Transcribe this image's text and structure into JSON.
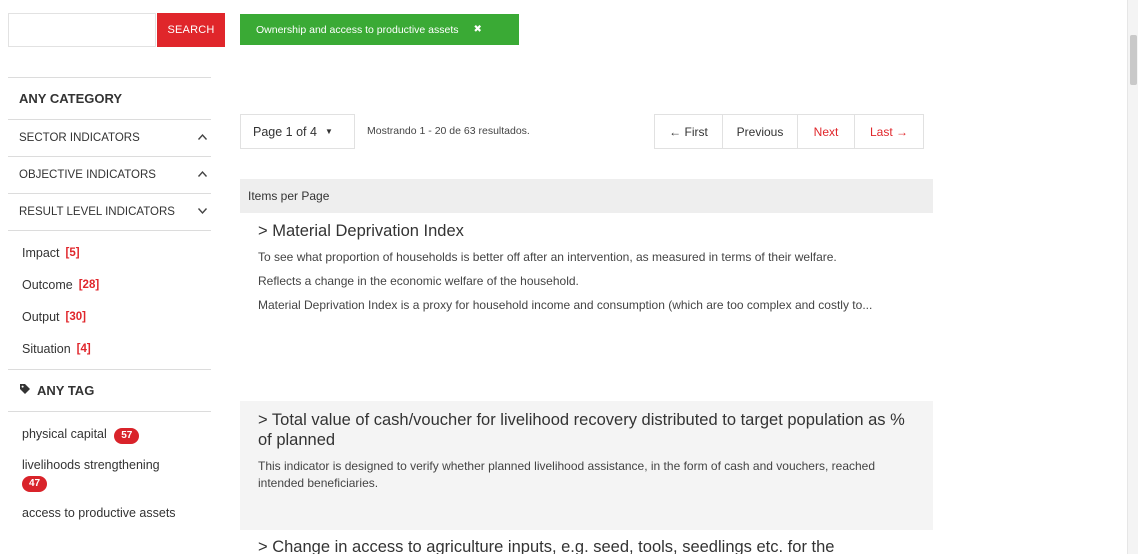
{
  "search": {
    "placeholder": "",
    "button_label": "SEARCH"
  },
  "active_filter": {
    "label": "Ownership and access to productive assets",
    "remove_icon": "close-icon",
    "color": "#3aaa35"
  },
  "sidebar": {
    "category_heading": "ANY CATEGORY",
    "categories": [
      {
        "label": "SECTOR INDICATORS",
        "chevron": "^"
      },
      {
        "label": "OBJECTIVE INDICATORS",
        "chevron": "^"
      },
      {
        "label": "RESULT LEVEL INDICATORS",
        "chevron": "v"
      }
    ],
    "result_levels": [
      {
        "label": "Impact",
        "count": "[5]"
      },
      {
        "label": "Outcome",
        "count": "[28]"
      },
      {
        "label": "Output",
        "count": "[30]"
      },
      {
        "label": "Situation",
        "count": "[4]"
      }
    ],
    "tag_heading": "ANY TAG",
    "tags": [
      {
        "label": "physical capital",
        "count": "57"
      },
      {
        "label": "livelihoods strengthening",
        "count": "47"
      },
      {
        "label": "access to productive assets",
        "count": ""
      }
    ]
  },
  "pager": {
    "page_select": "Page 1 of 4",
    "info": "Mostrando 1 - 20 de 63 resultados.",
    "first": "← First",
    "previous": "Previous",
    "next": "Next",
    "last": "Last →"
  },
  "items_per_page_label": "Items per Page",
  "results": [
    {
      "title": "> Material Deprivation Index",
      "paragraphs": [
        "To see what proportion of households is better off after an intervention, as measured in terms of their welfare.",
        "Reflects a change in the economic welfare of the household.",
        "Material Deprivation Index is a proxy for household income and consumption (which are too complex and costly to..."
      ]
    },
    {
      "title": "> Total value of cash/voucher for livelihood recovery distributed to target population as % of planned",
      "paragraphs": [
        "This indicator is designed to verify whether planned livelihood assistance, in the form of cash and vouchers, reached intended beneficiaries."
      ]
    },
    {
      "title": "> Change in access to agriculture inputs, e.g. seed, tools, seedlings etc. for the",
      "paragraphs": []
    }
  ],
  "colors": {
    "accent_red": "#e0262b",
    "badge_red": "#d9232a",
    "filter_green": "#3aaa35"
  }
}
